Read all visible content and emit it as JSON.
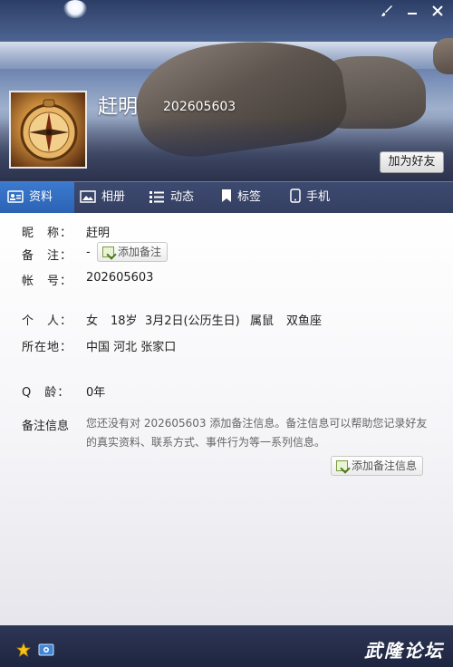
{
  "profile": {
    "nickname": "赶明",
    "qq_number": "202605603",
    "add_friend_label": "加为好友"
  },
  "tabs": [
    {
      "label": "资料",
      "icon": "profile-card-icon",
      "active": true
    },
    {
      "label": "相册",
      "icon": "photo-album-icon",
      "active": false
    },
    {
      "label": "动态",
      "icon": "feed-list-icon",
      "active": false
    },
    {
      "label": "标签",
      "icon": "bookmark-icon",
      "active": false
    },
    {
      "label": "手机",
      "icon": "mobile-phone-icon",
      "active": false
    }
  ],
  "info": {
    "nickname_label": "昵　称：",
    "nickname_value": "赶明",
    "remark_label": "备　注：",
    "remark_value": "-",
    "add_remark_label": "添加备注",
    "account_label": "帐　号：",
    "account_value": "202605603",
    "personal_label": "个　人：",
    "gender": "女",
    "age": "18岁",
    "birthday": "3月2日(公历生日)",
    "zodiac": "属鼠",
    "constellation": "双鱼座",
    "location_label": "所在地：",
    "location_value": "中国 河北 张家口",
    "qage_label": "Q　龄：",
    "qage_value": "0年",
    "remark_info_label": "备注信息",
    "remark_info_text": "您还没有对 202605603 添加备注信息。备注信息可以帮助您记录好友的真实资料、联系方式、事件行为等一系列信息。",
    "add_remark_info_label": "添加备注信息"
  },
  "footer": {
    "forum_text": "武隆论坛"
  },
  "colors": {
    "tab_active": "#2f6cc2",
    "tab_bar": "#394668",
    "footer": "#252d4a"
  }
}
